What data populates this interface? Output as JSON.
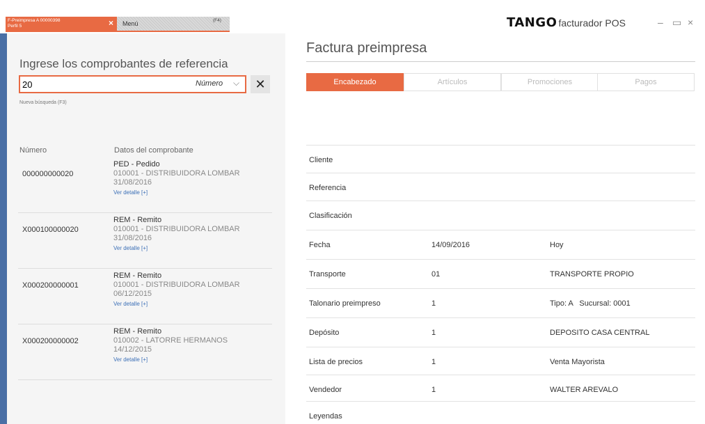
{
  "tabs": {
    "active_line1": "F-Preimpresa A 00000398",
    "active_line2": "Perfil 5",
    "active_close": "×",
    "menu_label": "Menú",
    "menu_key": "(F4)"
  },
  "brand": {
    "logo": "TANGO",
    "product": "facturador POS"
  },
  "window": {
    "minimize": "–",
    "maximize": "▭",
    "close": "×"
  },
  "left": {
    "heading": "Ingrese los comprobantes de referencia",
    "search_value": "20",
    "search_type": "Número",
    "search_chevron": "⌵",
    "clear": "✕",
    "nueva_busqueda": "Nueva búsqueda (F3)",
    "col_numero": "Número",
    "col_datos": "Datos del comprobante",
    "results": [
      {
        "numero": "000000000020",
        "tipo": "PED - Pedido",
        "cliente": "010001 - DISTRIBUIDORA LOMBAR",
        "fecha": "31/08/2016",
        "detalle": "Ver detalle [+]"
      },
      {
        "numero": "X000100000020",
        "tipo": "REM - Remito",
        "cliente": "010001 - DISTRIBUIDORA LOMBAR",
        "fecha": "31/08/2016",
        "detalle": "Ver detalle [+]"
      },
      {
        "numero": "X000200000001",
        "tipo": "REM - Remito",
        "cliente": "010001 - DISTRIBUIDORA LOMBAR",
        "fecha": "06/12/2015",
        "detalle": "Ver detalle [+]"
      },
      {
        "numero": "X000200000002",
        "tipo": "REM - Remito",
        "cliente": "010002 - LATORRE HERMANOS",
        "fecha": "14/12/2015",
        "detalle": "Ver detalle [+]"
      }
    ]
  },
  "right": {
    "title": "Factura preimpresa",
    "tabs": [
      {
        "label": "Encabezado"
      },
      {
        "label": "Artículos"
      },
      {
        "label": "Promociones"
      },
      {
        "label": "Pagos"
      }
    ],
    "fields": [
      {
        "label": "Cliente",
        "value": "",
        "extra": ""
      },
      {
        "label": "Referencia",
        "value": "",
        "extra": ""
      },
      {
        "label": "Clasificación",
        "value": "",
        "extra": ""
      },
      {
        "label": "Fecha",
        "value": "14/09/2016",
        "extra": "Hoy"
      },
      {
        "label": "Transporte",
        "value": "01",
        "extra": "TRANSPORTE PROPIO"
      },
      {
        "label": "Talonario preimpreso",
        "value": "1",
        "extra": "Tipo: A   Sucursal: 0001"
      },
      {
        "label": "Depósito",
        "value": "1",
        "extra": "DEPOSITO CASA CENTRAL"
      },
      {
        "label": "Lista de precios",
        "value": "1",
        "extra": "Venta Mayorista"
      },
      {
        "label": "Vendedor",
        "value": "1",
        "extra": "WALTER AREVALO"
      },
      {
        "label": "Leyendas",
        "value": "",
        "extra": ""
      }
    ]
  },
  "colors": {
    "accent": "#e86a43",
    "left_bar": "#4a6fa5",
    "link": "#3b6fb6"
  }
}
